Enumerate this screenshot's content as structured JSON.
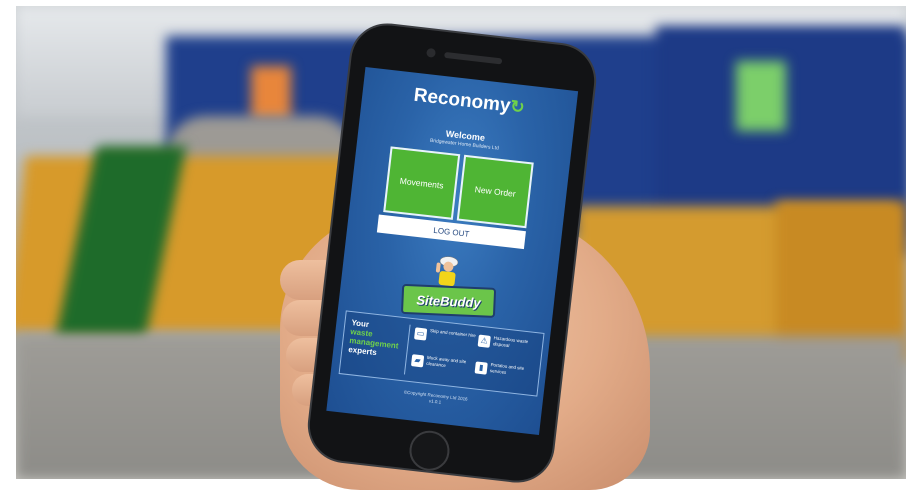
{
  "app": {
    "brand": "Reconomy",
    "welcome_title": "Welcome",
    "welcome_subtitle": "Bridgewater Home Builders Ltd"
  },
  "tiles": {
    "movements": "Movements",
    "new_order": "New Order"
  },
  "actions": {
    "logout": "LOG OUT"
  },
  "mascot": {
    "name": "SiteBuddy"
  },
  "promo": {
    "line1": "Your",
    "line2": "waste",
    "line3": "management",
    "line4": "experts",
    "services": [
      {
        "icon": "skip-icon",
        "label": "Skip and container hire"
      },
      {
        "icon": "hazard-icon",
        "label": "Hazardous waste disposal"
      },
      {
        "icon": "truck-icon",
        "label": "Muck away and site clearance"
      },
      {
        "icon": "toilet-icon",
        "label": "Portaloo and site services"
      }
    ]
  },
  "footer": {
    "copyright": "©Copyright Reconomy Ltd 2016",
    "version": "v1.0.1"
  },
  "colors": {
    "screen_blue": "#2a63a8",
    "tile_green": "#4fb534",
    "accent_green": "#6fd14b"
  }
}
